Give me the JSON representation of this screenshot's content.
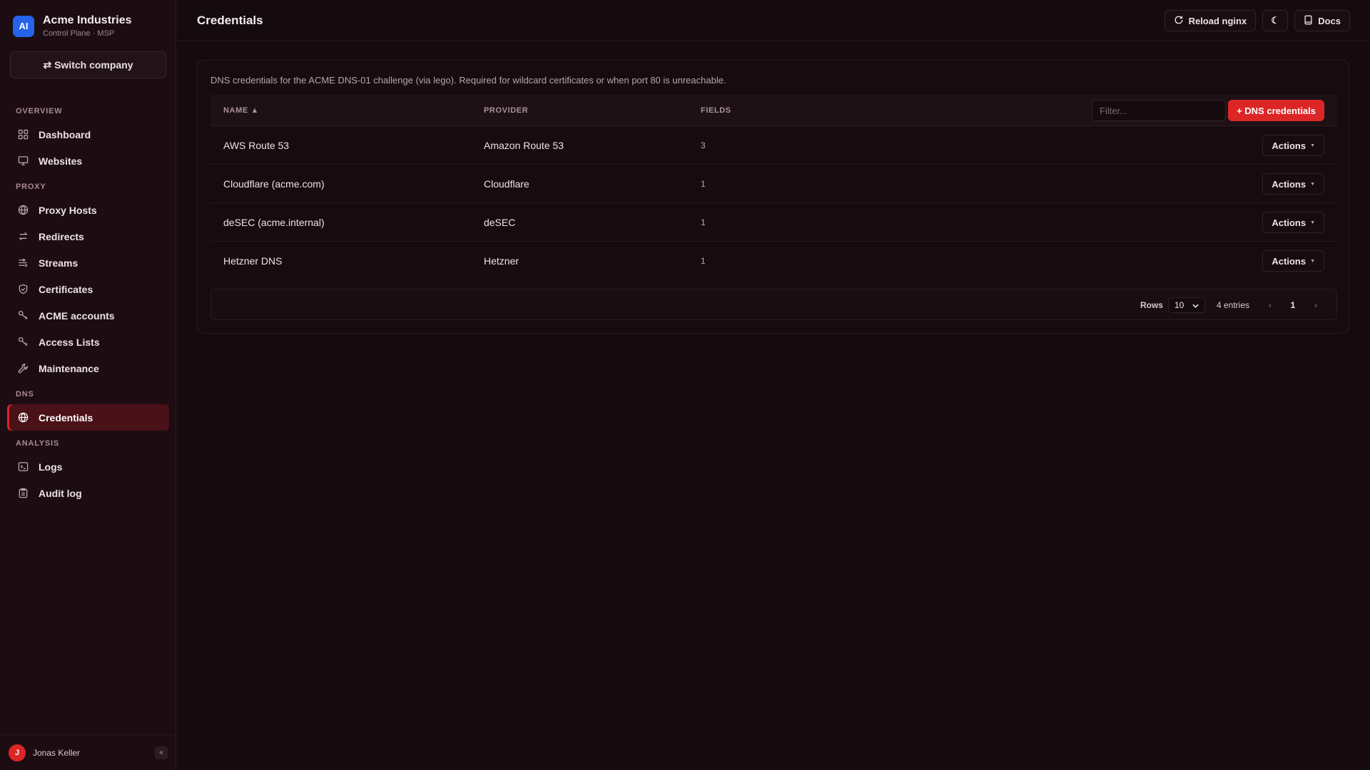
{
  "brand": {
    "logo": "AI",
    "name": "Acme Industries",
    "subtitle": "Control Plane · MSP"
  },
  "switch_company": "⇄ Switch company",
  "nav": {
    "sections": [
      {
        "title": "OVERVIEW",
        "items": [
          {
            "label": "Dashboard",
            "icon": "dashboard-icon"
          },
          {
            "label": "Websites",
            "icon": "monitor-icon"
          }
        ]
      },
      {
        "title": "PROXY",
        "items": [
          {
            "label": "Proxy Hosts",
            "icon": "globe-icon"
          },
          {
            "label": "Redirects",
            "icon": "redirect-icon"
          },
          {
            "label": "Streams",
            "icon": "streams-icon"
          },
          {
            "label": "Certificates",
            "icon": "shield-icon"
          },
          {
            "label": "ACME accounts",
            "icon": "key-icon"
          },
          {
            "label": "Access Lists",
            "icon": "key-icon"
          },
          {
            "label": "Maintenance",
            "icon": "wrench-icon"
          }
        ]
      },
      {
        "title": "DNS",
        "items": [
          {
            "label": "Credentials",
            "icon": "globe-icon",
            "active": true
          }
        ]
      },
      {
        "title": "ANALYSIS",
        "items": [
          {
            "label": "Logs",
            "icon": "terminal-icon"
          },
          {
            "label": "Audit log",
            "icon": "clipboard-icon"
          }
        ]
      }
    ]
  },
  "user": {
    "initial": "J",
    "name": "Jonas Keller",
    "collapse": "«"
  },
  "header": {
    "title": "Credentials",
    "reload_label": "Reload nginx",
    "theme_icon": "☾",
    "docs_label": "Docs"
  },
  "main": {
    "description": "DNS credentials for the ACME DNS-01 challenge (via lego). Required for wildcard certificates or when port 80 is unreachable.",
    "columns": {
      "name": "NAME ▲",
      "provider": "PROVIDER",
      "fields": "FIELDS"
    },
    "filter_placeholder": "Filter...",
    "add_label": "+ DNS credentials",
    "action_label": "Actions",
    "rows": [
      {
        "name": "AWS Route 53",
        "provider": "Amazon Route 53",
        "fields": "3"
      },
      {
        "name": "Cloudflare (acme.com)",
        "provider": "Cloudflare",
        "fields": "1"
      },
      {
        "name": "deSEC (acme.internal)",
        "provider": "deSEC",
        "fields": "1"
      },
      {
        "name": "Hetzner DNS",
        "provider": "Hetzner",
        "fields": "1"
      }
    ],
    "pager": {
      "rows_label": "Rows",
      "rows_value": "10",
      "entries": "4 entries",
      "page": "1",
      "prev": "‹",
      "next": "›"
    }
  },
  "colors": {
    "accent": "#dc2626",
    "brand_logo": "#2563eb",
    "active_nav_bg": "#4a1118"
  }
}
